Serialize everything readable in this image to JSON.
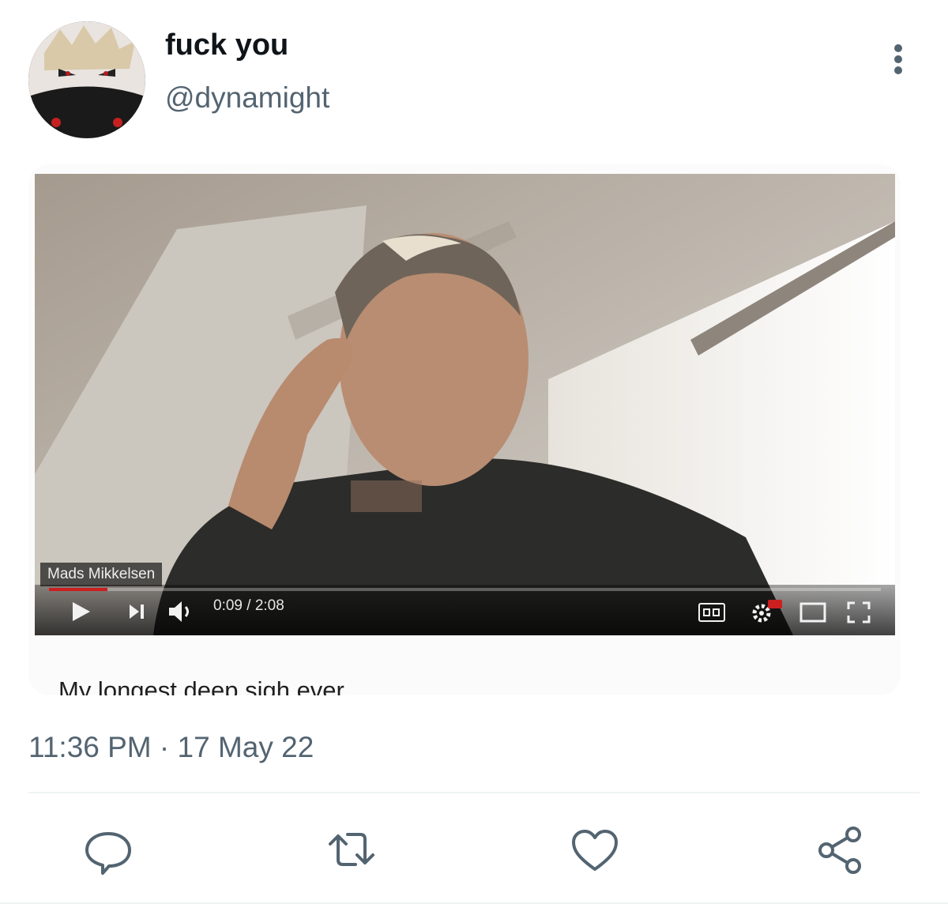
{
  "tweet": {
    "display_name": "fuck you",
    "handle": "@dynamight",
    "timestamp": "11:36 PM · 17 May 22"
  },
  "media": {
    "video_overlay_name": "Mads Mikkelsen",
    "player": {
      "time": "0:09 / 2:08",
      "progress": 0.07
    },
    "caption": "My longest deep sigh ever"
  },
  "actions": [
    "reply-icon",
    "retweet-icon",
    "like-icon",
    "share-icon"
  ],
  "colors": {
    "text_primary": "#0f1419",
    "text_secondary": "#536471",
    "player_progress": "#cc1f1f",
    "divider": "#eff3f4"
  }
}
